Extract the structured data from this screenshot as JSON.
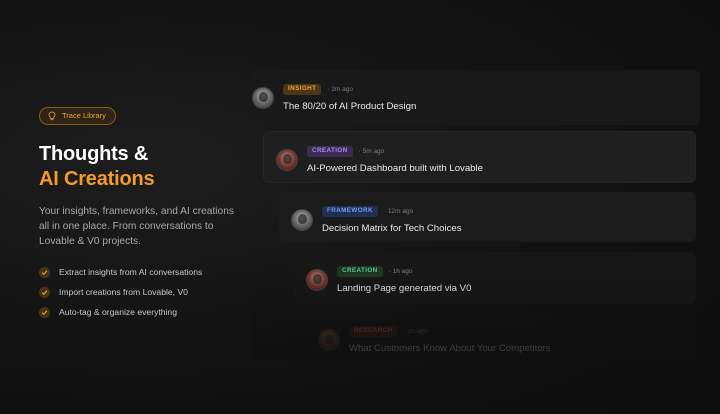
{
  "hero": {
    "badge_label": "Trace Library",
    "title_line1": "Thoughts &",
    "title_line2": "AI Creations",
    "description": "Your insights, frameworks, and AI creations all in one place. From conversations to Lovable & V0 projects.",
    "features": [
      "Extract insights from AI conversations",
      "Import creations from Lovable, V0",
      "Auto-tag & organize everything"
    ]
  },
  "feed": {
    "items": [
      {
        "tag": "INSIGHT",
        "time": "· 2m ago",
        "title": "The 80/20 of AI Product Design"
      },
      {
        "tag": "CREATION",
        "time": "· 5m ago",
        "title": "AI-Powered Dashboard built with Lovable"
      },
      {
        "tag": "FRAMEWORK",
        "time": "· 12m ago",
        "title": "Decision Matrix for Tech Choices"
      },
      {
        "tag": "CREATION",
        "time": "· 1h ago",
        "title": "Landing Page generated via V0"
      },
      {
        "tag": "RESEARCH",
        "time": "· 1h ago",
        "title": "What Customers Know About Your Competitors"
      }
    ]
  },
  "colors": {
    "accent": "#f39a2b",
    "background": "#121212",
    "insight": "#f0a43a",
    "creation": "#a88af0",
    "framework": "#6f9cf0",
    "creation_green": "#55c58a",
    "research": "#e06a6a"
  },
  "icons": {
    "badge": "lightbulb-icon",
    "feature": "check-icon"
  }
}
